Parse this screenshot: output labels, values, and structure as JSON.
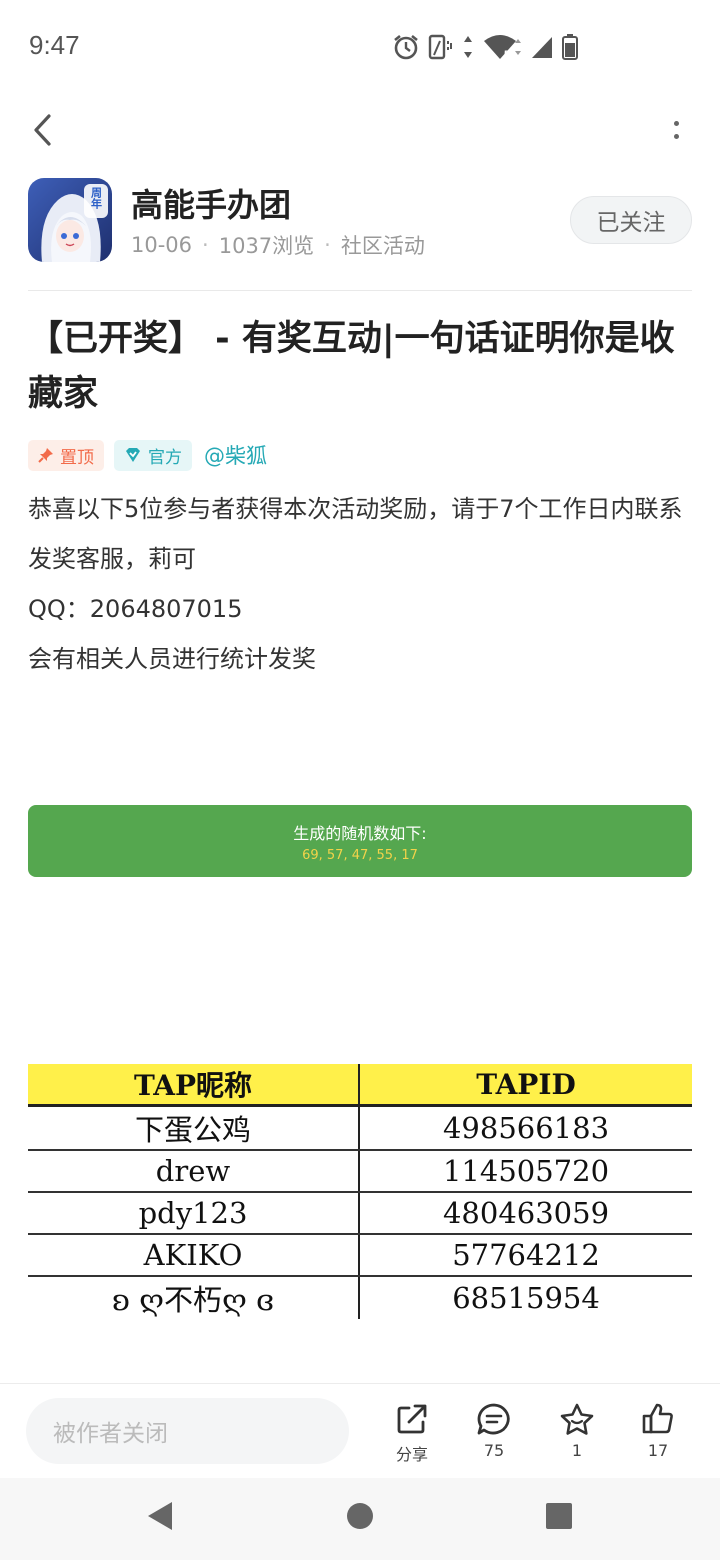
{
  "status_bar": {
    "time": "9:47",
    "icons": [
      "alarm-icon",
      "vibrate-icon",
      "data-arrows-icon",
      "wifi-icon",
      "cell-signal-icon",
      "battery-icon"
    ],
    "wifi_badge": "5"
  },
  "nav": {
    "back_icon": "chevron-left-icon",
    "more_icon": "more-vertical-icon"
  },
  "author": {
    "name": "高能手办团",
    "avatar_badge": "周年",
    "date": "10-06",
    "views": "1037浏览",
    "category": "社区活动",
    "follow_label": "已关注"
  },
  "post": {
    "title": "【已开奖】 - 有奖互动|一句话证明你是收藏家",
    "tags": {
      "pin": "置顶",
      "official": "官方",
      "mention": "@柴狐"
    },
    "body": [
      "恭喜以下5位参与者获得本次活动奖励，请于7个工作日内联系发奖客服，莉可",
      "QQ：2064807015",
      "会有相关人员进行统计发奖"
    ]
  },
  "random_box": {
    "label": "生成的随机数如下:",
    "numbers": "69, 57, 47, 55, 17"
  },
  "winners_table": {
    "headers": [
      "TAP昵称",
      "TAPID"
    ],
    "rows": [
      [
        "下蛋公鸡",
        "498566183"
      ],
      [
        "drew",
        "114505720"
      ],
      [
        "pdy123",
        "480463059"
      ],
      [
        "AKIKO",
        "57764212"
      ],
      [
        "ʚ ღ不朽ღ ɞ",
        "68515954"
      ]
    ]
  },
  "action_bar": {
    "comment_placeholder": "被作者关闭",
    "share_label": "分享",
    "comment_count": "75",
    "favorite_count": "1",
    "like_count": "17"
  },
  "colors": {
    "accent_teal": "#25a9b5",
    "pin_orange": "#f26b4a",
    "random_green": "#55a74f",
    "random_numbers_yellow": "#f2d34a",
    "table_header_yellow": "#fff04a"
  }
}
